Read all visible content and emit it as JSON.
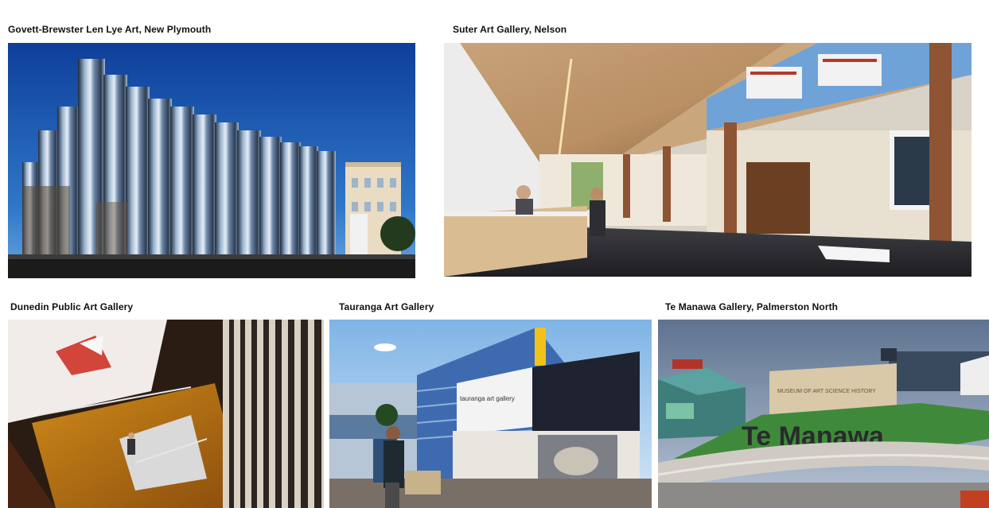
{
  "captions": {
    "govett": "Govett-Brewster  Len  Lye Art, New Plymouth",
    "suter": "Suter Art Gallery, Nelson",
    "dunedin": "Dunedin  Public  Art Gallery",
    "tauranga": "Tauranga  Art Gallery",
    "temanawa": "Te Manawa Gallery,  Palmerston North"
  },
  "signage": {
    "tauranga_banner": "tauranga art gallery",
    "temanawa_wall": "MUSEUM OF ART SCIENCE HISTORY",
    "temanawa_letters": "Te Manawa"
  }
}
